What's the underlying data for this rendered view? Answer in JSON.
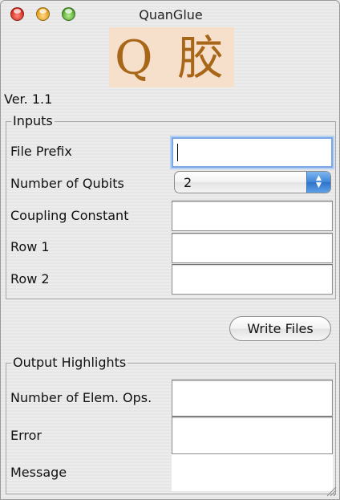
{
  "window": {
    "title": "QuanGlue"
  },
  "logo": {
    "text": "Q 胶"
  },
  "version_text": "Ver. 1.1",
  "inputs": {
    "legend": "Inputs",
    "file_prefix": {
      "label": "File Prefix",
      "value": ""
    },
    "num_qubits": {
      "label": "Number of Qubits",
      "value": "2"
    },
    "coupling_constant": {
      "label": "Coupling Constant",
      "value": ""
    },
    "row1": {
      "label": "Row 1",
      "value": ""
    },
    "row2": {
      "label": "Row 2",
      "value": ""
    }
  },
  "actions": {
    "write_files_label": "Write Files"
  },
  "outputs": {
    "legend": "Output Highlights",
    "num_elem_ops": {
      "label": "Number of Elem. Ops.",
      "value": ""
    },
    "error": {
      "label": "Error",
      "value": ""
    },
    "message": {
      "label": "Message",
      "value": ""
    }
  },
  "colors": {
    "logo_bg": "#f6e0cc",
    "logo_fg": "#a86618",
    "focus_ring": "#7aa7e6"
  }
}
